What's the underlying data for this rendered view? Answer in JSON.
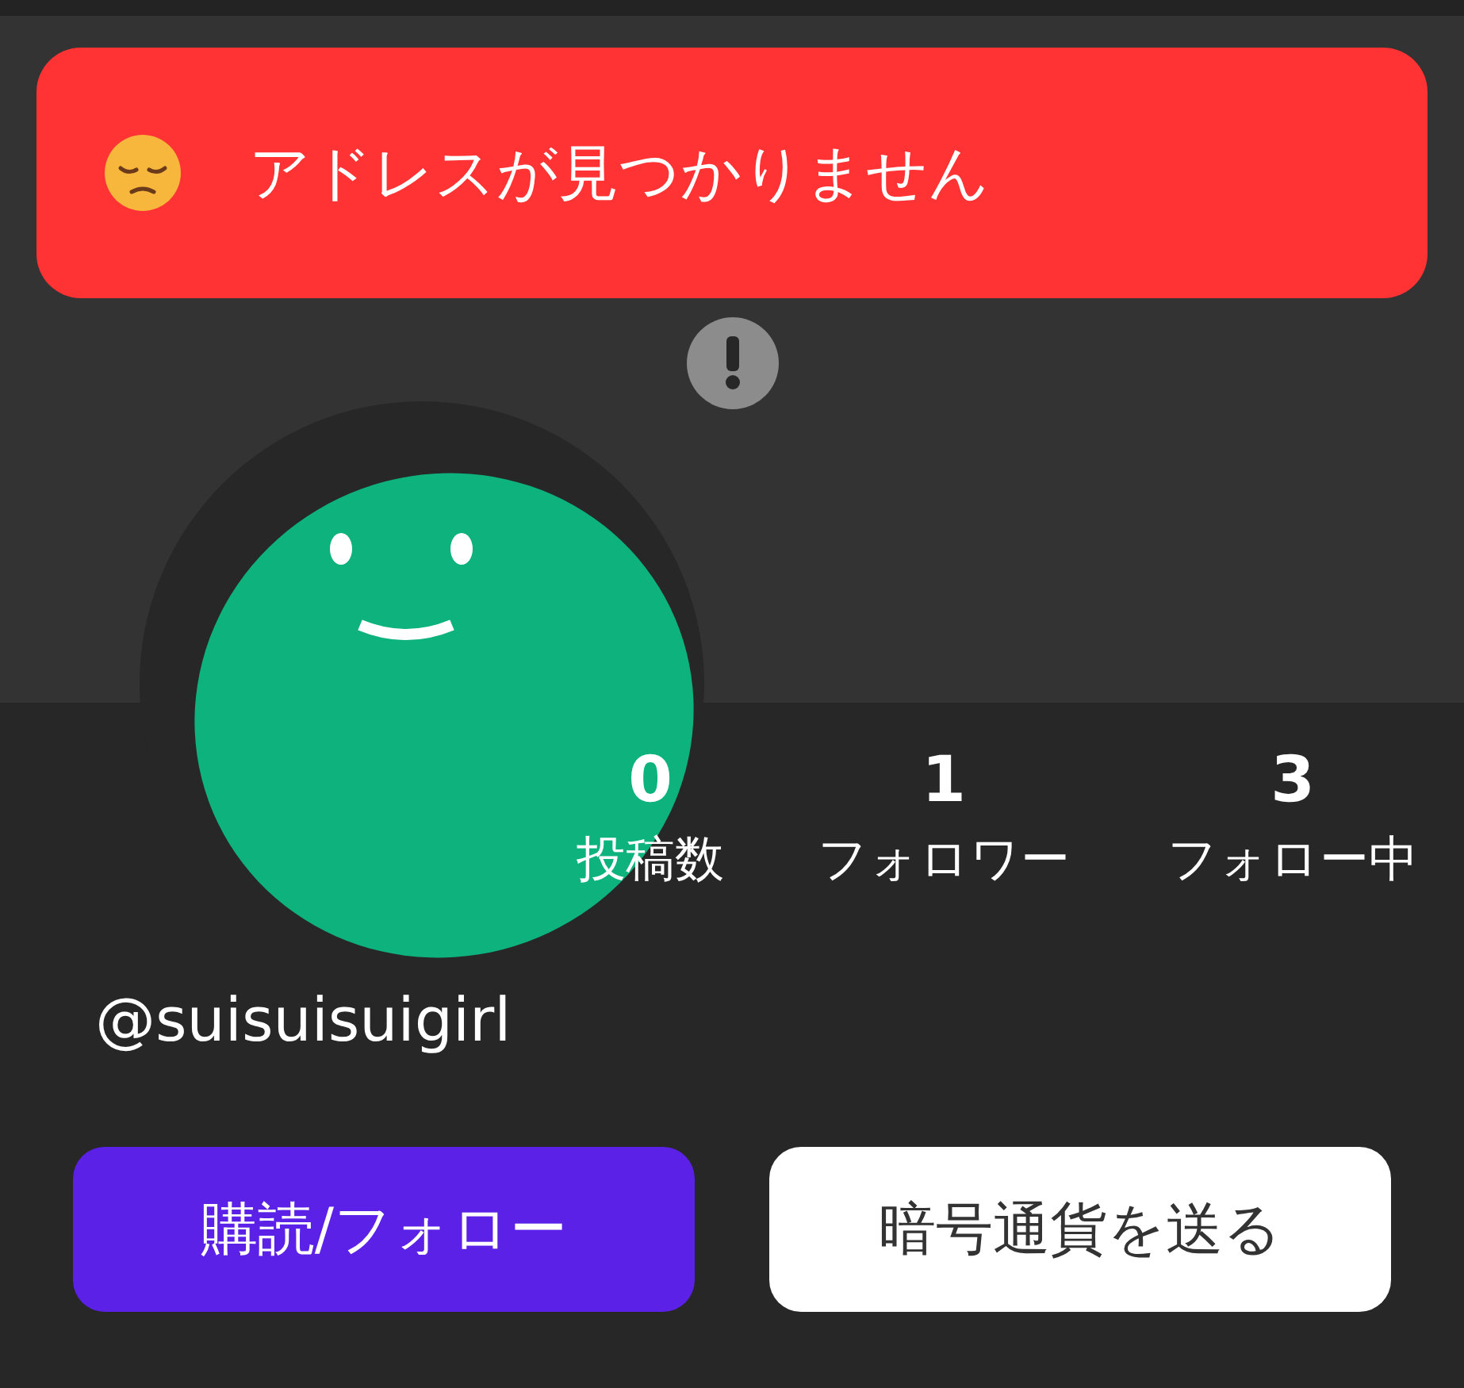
{
  "toast": {
    "message": "アドレスが見つかりません"
  },
  "stats": [
    {
      "value": "0",
      "label": "投稿数"
    },
    {
      "value": "1",
      "label": "フォロワー"
    },
    {
      "value": "3",
      "label": "フォロー中"
    }
  ],
  "handle": "@suisuisuigirl",
  "buttons": [
    {
      "label": "購読/フォロー",
      "kind": "primary"
    },
    {
      "label": "暗号通貨を送る",
      "kind": "secondary"
    }
  ]
}
